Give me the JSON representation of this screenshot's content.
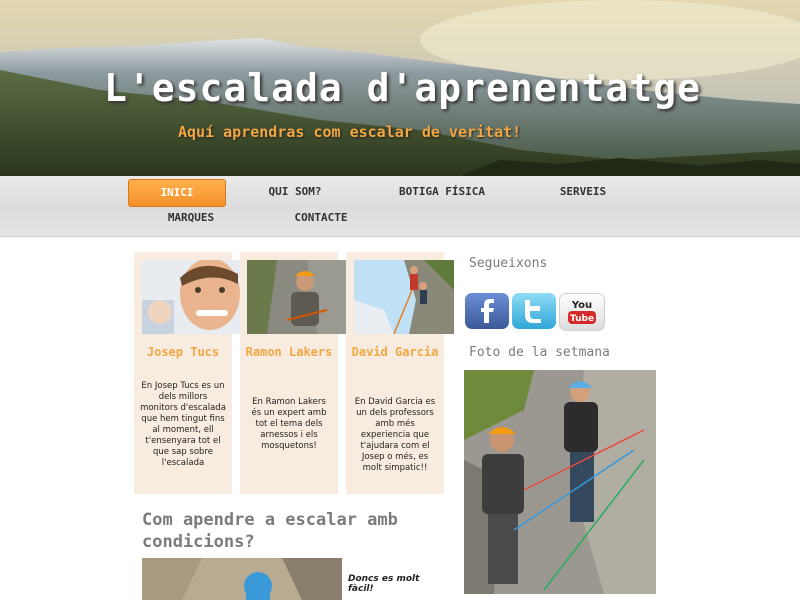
{
  "header": {
    "title": "L'escalada d'aprenentatge",
    "tagline": "Aquí aprendras com escalar de veritat!"
  },
  "nav": {
    "items": [
      {
        "label": "INICI",
        "active": true
      },
      {
        "label": "QUI SOM?"
      },
      {
        "label": "BOTIGA FÍSICA"
      },
      {
        "label": "SERVEIS"
      },
      {
        "label": "MARQUES"
      },
      {
        "label": "CONTACTE"
      }
    ]
  },
  "team": [
    {
      "name": "Josep Tucs",
      "desc": "En Josep Tucs es un dels millors monitors d'escalada que hem tingut fins al moment, ell t'ensenyara tot el que sap sobre l'escalada"
    },
    {
      "name": "Ramon Lakers",
      "desc": "En Ramon Lakers és un expert amb tot el tema dels arnessos i els mosquetons!"
    },
    {
      "name": "David Garcia",
      "desc": "En David Garcia es un dels professors amb més experiencia que t'ajudara com el Josep o més, es molt simpatic!!"
    }
  ],
  "sidebar": {
    "follow_heading": "Segueixons",
    "photo_heading": "Foto de la setmana",
    "social": [
      "facebook-icon",
      "twitter-icon",
      "youtube-icon"
    ],
    "youtube_label_1": "You",
    "youtube_label_2": "Tube"
  },
  "article": {
    "title": "Com apendre a escalar amb condicions?",
    "caption": "Doncs es molt fàcil!"
  },
  "colors": {
    "accent": "#f2a743",
    "nav_active": "#f5912a",
    "card_bg": "#f7ecdf",
    "heading_gray": "#7b7b7b"
  }
}
